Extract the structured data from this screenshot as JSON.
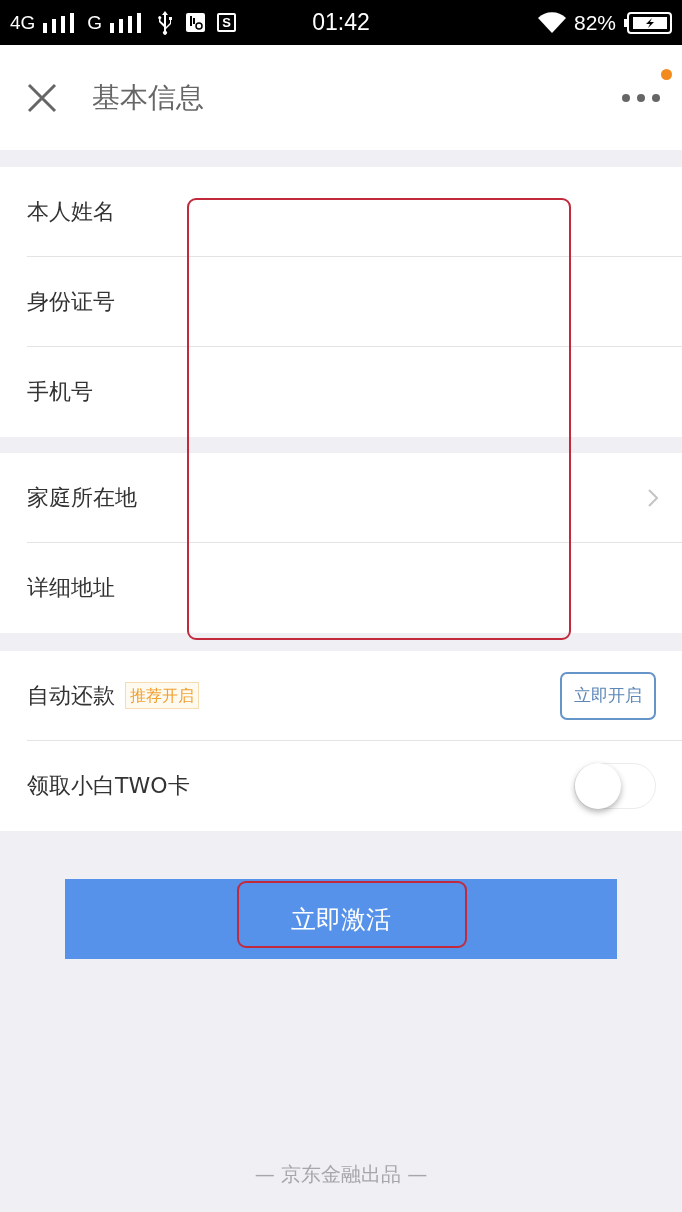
{
  "status_bar": {
    "network_primary": "4G",
    "network_secondary": "G",
    "app_letter": "S",
    "time": "01:42",
    "battery": "82%"
  },
  "header": {
    "title": "基本信息",
    "notification_dot": true
  },
  "form": {
    "highlighted": true,
    "sections": [
      {
        "rows": [
          {
            "kind": "input",
            "label": "本人姓名"
          },
          {
            "kind": "input",
            "label": "身份证号"
          },
          {
            "kind": "input",
            "label": "手机号"
          }
        ]
      },
      {
        "rows": [
          {
            "kind": "select",
            "label": "家庭所在地"
          },
          {
            "kind": "input",
            "label": "详细地址"
          }
        ]
      }
    ]
  },
  "options": [
    {
      "kind": "action",
      "label": "自动还款",
      "badge": "推荐开启",
      "button": "立即开启"
    },
    {
      "kind": "toggle",
      "label": "领取小白TWO卡",
      "on": false
    }
  ],
  "activate_button": {
    "label": "立即激活",
    "highlighted": true
  },
  "footer": "— 京东金融出品 —"
}
